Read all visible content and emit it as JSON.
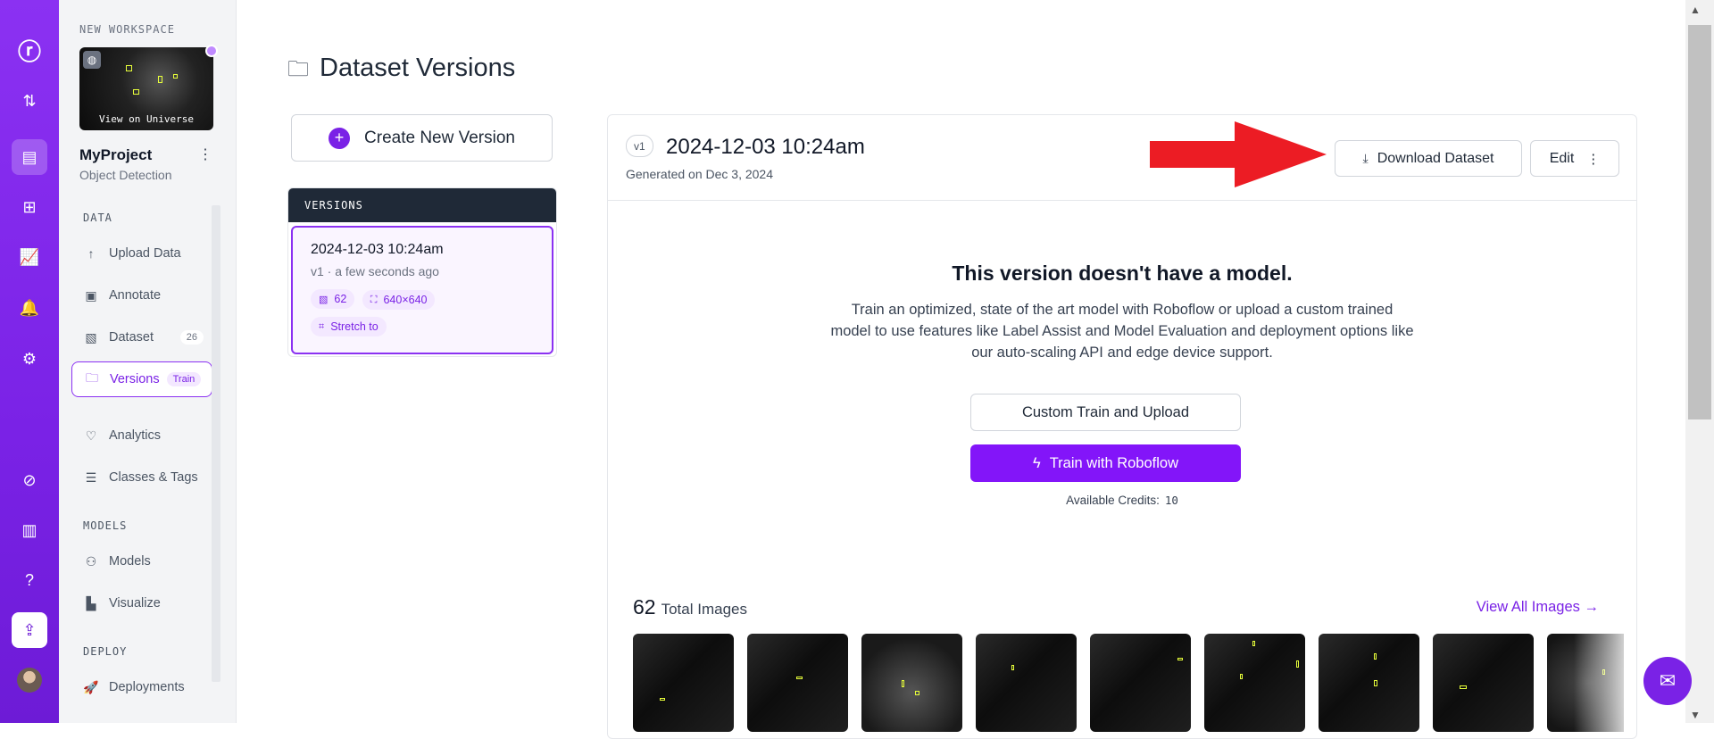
{
  "rail": {
    "icons": [
      "roboflow-logo-icon",
      "transfer-icon",
      "inbox-icon",
      "sitemap-icon",
      "chart-icon",
      "bell-icon",
      "settings-icon",
      "explore-icon",
      "library-icon",
      "help-icon",
      "upload-icon"
    ]
  },
  "sidebar": {
    "workspace_label": "NEW WORKSPACE",
    "universe_label": "View on Universe",
    "project_name": "MyProject",
    "project_type": "Object Detection",
    "sections": {
      "data": "DATA",
      "models": "MODELS",
      "deploy": "DEPLOY"
    },
    "items": [
      {
        "label": "Upload Data",
        "icon": "upload-arrow-icon"
      },
      {
        "label": "Annotate",
        "icon": "annotate-icon"
      },
      {
        "label": "Dataset",
        "icon": "image-icon",
        "badge": "26"
      },
      {
        "label": "Versions",
        "icon": "folder-icon",
        "badge": "Train"
      },
      {
        "label": "Analytics",
        "icon": "heart-pulse-icon"
      },
      {
        "label": "Classes & Tags",
        "icon": "list-icon"
      },
      {
        "label": "Models",
        "icon": "network-icon"
      },
      {
        "label": "Visualize",
        "icon": "bar-chart-icon"
      },
      {
        "label": "Deployments",
        "icon": "rocket-icon"
      }
    ]
  },
  "page": {
    "title": "Dataset Versions"
  },
  "create_button": "Create New Version",
  "versions": {
    "header": "VERSIONS",
    "card": {
      "title": "2024-12-03 10:24am",
      "subtitle": "v1 · a few seconds ago",
      "image_count": "62",
      "size": "640×640",
      "resize": "Stretch to"
    }
  },
  "detail": {
    "version_tag": "v1",
    "title": "2024-12-03 10:24am",
    "generated": "Generated on Dec 3, 2024",
    "download_label": "Download Dataset",
    "edit_label": "Edit",
    "no_model_title": "This version doesn't have a model.",
    "description_lines": [
      "Train an optimized, state of the art model with Roboflow or upload a custom trained",
      "model to use features like Label Assist and Model Evaluation and deployment options like",
      "our auto-scaling API and edge device support."
    ],
    "custom_train_label": "Custom Train and Upload",
    "train_label": "Train with Roboflow",
    "credits_label": "Available Credits:",
    "credits_value": "10",
    "total_images_count": "62",
    "total_images_label": "Total Images",
    "view_all_label": "View All Images →"
  },
  "colors": {
    "brand": "#7a22e6",
    "primary_button": "#8315f9",
    "annotation_arrow": "#ec1c24",
    "box": "#e8ff3a"
  }
}
